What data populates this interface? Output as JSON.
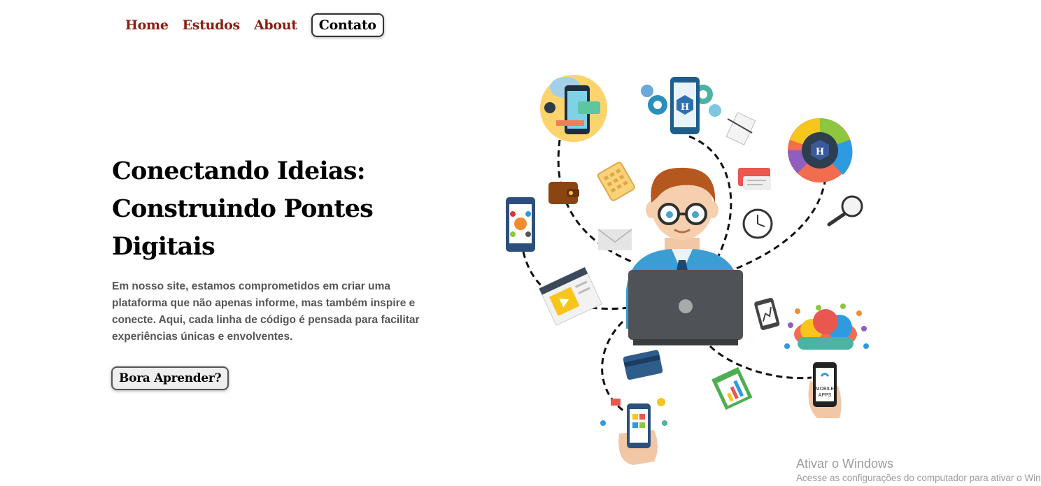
{
  "nav": {
    "links": [
      "Home",
      "Estudos",
      "About"
    ],
    "contact_button": "Contato"
  },
  "hero": {
    "title": "Conectando Ideias: Construindo Pontes Digitais",
    "description": "Em nosso site, estamos comprometidos em criar uma plataforma que não apenas informe, mas também inspire e conecte. Aqui, cada linha de código é pensada para facilitar experiências únicas e envolventes.",
    "cta_label": "Bora Aprender?"
  },
  "illustration": {
    "hybrid_label": "H",
    "mobile_apps_line1": "MOBILE",
    "mobile_apps_line2": "APPS"
  },
  "watermark": {
    "title": "Ativar o Windows",
    "subtitle": "Acesse as configurações do computador para ativar o Windows."
  },
  "colors": {
    "nav_link": "#8b1d0f",
    "text_body": "#555555",
    "shirt": "#3b9ed2",
    "laptop": "#4f5357"
  }
}
